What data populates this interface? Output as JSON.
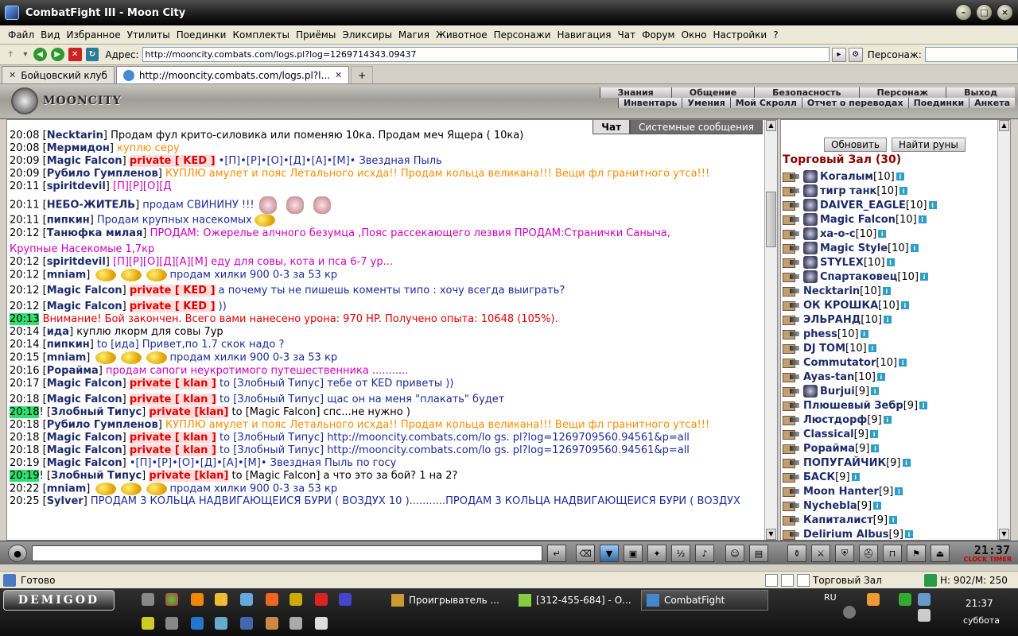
{
  "window": {
    "title": "CombatFight III - Moon City"
  },
  "menu": [
    "Файл",
    "Вид",
    "Избранное",
    "Утилиты",
    "Поединки",
    "Комплекты",
    "Приёмы",
    "Эликсиры",
    "Магия",
    "Животное",
    "Персонажи",
    "Навигация",
    "Чат",
    "Форум",
    "Окно",
    "Настройки",
    "?"
  ],
  "address": {
    "label": "Адрес:",
    "url": "http://mooncity.combats.com/logs.pl?log=1269714343.09437",
    "persona_label": "Персонаж:"
  },
  "tabs": [
    {
      "label": "Бойцовский клуб"
    },
    {
      "label": "http://mooncity.combats.com/logs.pl?l..."
    }
  ],
  "header": {
    "logo": "MOONCITY",
    "nav1": [
      "Знания",
      "Общение",
      "Безопасность",
      "Персонаж",
      "Выход"
    ],
    "nav2": [
      "Инвентарь",
      "Умения",
      "Мой Скролл",
      "Отчет о переводах",
      "Поединки",
      "Анкета"
    ]
  },
  "chat": {
    "tab_chat": "Чат",
    "tab_system": "Системные сообщения",
    "messages": [
      {
        "time": "20:08",
        "nick": "Necktarin",
        "text": "Продам фул крито-силовика или поменяю 10ка. Продам меч Ящера ( 10ка)",
        "color": "t-black"
      },
      {
        "time": "20:08",
        "nick": "Мермидон",
        "text": "куплю серу",
        "color": "t-orange"
      },
      {
        "time": "20:09",
        "nick": "Magic Falcon",
        "priv": "private [ KED ]",
        "text": "•[П]•[Р]•[О]•[Д]•[А]•[М]• Звездная Пыль",
        "color": "t-blue"
      },
      {
        "time": "20:09",
        "nick": "Рубило Гумпленов",
        "text": "КУПЛЮ амулет и пояс Летального исхда!! Продам кольца великана!!! Вещи фл гранитного утса!!!",
        "color": "t-orange"
      },
      {
        "time": "20:11",
        "nick": "spiritdevil",
        "text": "[П][Р][О][Д",
        "color": "t-pink"
      },
      {
        "time": "20:11",
        "nick": "НЕБО-ЖИТЕЛЬ",
        "text": "продам СВИНИНУ !!!",
        "color": "t-blue"
      },
      {
        "time": "20:11",
        "nick": "пипкин",
        "text": "Продам крупных насекомых",
        "color": "t-blue"
      },
      {
        "time": "20:12",
        "nick": "Танюфка милая",
        "text": "ПРОДАМ: Ожерелье алчного безумца ,Пояс рассекающего лезвия ПРОДАМ:Странички Саныча,",
        "color": "t-pink"
      },
      {
        "time": "",
        "nick": "",
        "text": "Крупные Насекомые 1,7кр",
        "color": "t-pink"
      },
      {
        "time": "20:12",
        "nick": "spiritdevil",
        "text": "[П][Р][О][Д][А][М] еду для совы, кота и пса 6-7 ур...",
        "color": "t-pink"
      },
      {
        "time": "20:12",
        "nick": "mniam",
        "text": "продам хилки 900 0-3 за 53 кр",
        "color": "t-blue"
      },
      {
        "time": "20:12",
        "nick": "Magic Falcon",
        "priv": "private [ KED ]",
        "text": "а почему ты не пишешь коменты типо : хочу всегда выиграть?",
        "color": "t-blue"
      },
      {
        "time": "20:12",
        "nick": "Magic Falcon",
        "priv": "private [ KED ]",
        "text": "))",
        "color": "t-blue"
      },
      {
        "time": "20:13",
        "nick": "",
        "text": "Внимание! Бой закончен. Всего вами нанесено урона: 970 HP. Получено опыта: 10648 (105%).",
        "color": "t-warn",
        "hl": true
      },
      {
        "time": "20:14",
        "nick": "ида",
        "text": "куплю лкорм для совы 7ур",
        "color": "t-black"
      },
      {
        "time": "20:14",
        "nick": "пипкин",
        "text": "to [ида] Привет,по 1.7 скок надо ?",
        "color": "t-blue"
      },
      {
        "time": "20:15",
        "nick": "mniam",
        "text": "продам хилки 900 0-3 за 53 кр",
        "color": "t-blue"
      },
      {
        "time": "20:16",
        "nick": "Рорайма",
        "text": "продам сапоги неукротимого путешественника ...........",
        "color": "t-pink"
      },
      {
        "time": "20:17",
        "nick": "Magic Falcon",
        "priv": "private [ klan ]",
        "text": "to [Злобный Типус] тебе от KED приветы ))",
        "color": "t-blue"
      },
      {
        "time": "20:18",
        "nick": "Magic Falcon",
        "priv": "private [ klan ]",
        "text": "to [Злобный Типус] щас он на меня \"плакать\" будет",
        "color": "t-blue"
      },
      {
        "time": "20:18",
        "nick": "Злобный Типус",
        "priv": "private [klan]",
        "text": "to [Magic Falcon] спс...не нужно )",
        "color": "t-black",
        "hl": true,
        "bang": true
      },
      {
        "time": "20:18",
        "nick": "Рубило Гумпленов",
        "text": "КУПЛЮ амулет и пояс Летального исхда!! Продам кольца великана!!! Вещи фл гранитного утса!!!",
        "color": "t-orange"
      },
      {
        "time": "20:18",
        "nick": "Magic Falcon",
        "priv": "private [ klan ]",
        "text": "to [Злобный Типус] http://mooncity.combats.com/lo gs. pl?log=1269709560.94561&p=all",
        "color": "t-blue"
      },
      {
        "time": "20:18",
        "nick": "Magic Falcon",
        "priv": "private [ klan ]",
        "text": "to [Злобный Типус] http://mooncity.combats.com/lo gs. pl?log=1269709560.94561&p=all",
        "color": "t-blue"
      },
      {
        "time": "20:19",
        "nick": "Magic Falcon",
        "text": "•[П]•[Р]•[О]•[Д]•[А]•[М]• Звездная Пыль по госу",
        "color": "t-blue"
      },
      {
        "time": "20:19",
        "nick": "Злобный Типус",
        "priv": "private [klan]",
        "text": "to [Magic Falcon] а что это за бой? 1 на 2?",
        "color": "t-black",
        "hl": true,
        "bang": true
      },
      {
        "time": "20:22",
        "nick": "mniam",
        "text": "продам хилки 900 0-3 за 53 кр",
        "color": "t-blue"
      },
      {
        "time": "20:25",
        "nick": "Sylver",
        "text": "ПРОДАМ 3 КОЛЬЦА НАДВИГАЮЩЕЙСЯ БУРИ ( ВОЗДУХ 10 )...........ПРОДАМ 3 КОЛЬЦА НАДВИГАЮЩЕЙСЯ БУРИ ( ВОЗДУХ",
        "color": "t-blue"
      }
    ]
  },
  "side": {
    "refresh": "Обновить",
    "find_runes": "Найти руны",
    "room_title": "Торговый Зал (30)",
    "users": [
      {
        "name": "Когалым",
        "lvl": "[10]",
        "clan": true
      },
      {
        "name": "тигр танк",
        "lvl": "[10]",
        "clan": true
      },
      {
        "name": "DAIVER_EAGLE",
        "lvl": "[10]",
        "clan": true
      },
      {
        "name": "Magic Falcon",
        "lvl": "[10]",
        "clan": true
      },
      {
        "name": "ха-о-с",
        "lvl": "[10]",
        "clan": true
      },
      {
        "name": "Magic Style",
        "lvl": "[10]",
        "clan": true
      },
      {
        "name": "STYLEX",
        "lvl": "[10]",
        "clan": true
      },
      {
        "name": "Спартаковец",
        "lvl": "[10]",
        "clan": true
      },
      {
        "name": "Necktarin",
        "lvl": "[10]",
        "clan": false
      },
      {
        "name": "ОК КРОШКА",
        "lvl": "[10]",
        "clan": false
      },
      {
        "name": "ЭЛЬРАНД",
        "lvl": "[10]",
        "clan": false
      },
      {
        "name": "phess",
        "lvl": "[10]",
        "clan": false
      },
      {
        "name": "DJ TOM",
        "lvl": "[10]",
        "clan": false
      },
      {
        "name": "Commutator",
        "lvl": "[10]",
        "clan": false
      },
      {
        "name": "Ayas-tan",
        "lvl": "[10]",
        "clan": false
      },
      {
        "name": "Burjui",
        "lvl": "[9]",
        "clan": true
      },
      {
        "name": "Плюшевый Зебр",
        "lvl": "[9]",
        "clan": false
      },
      {
        "name": "Люстдорф",
        "lvl": "[9]",
        "clan": false
      },
      {
        "name": "Classical",
        "lvl": "[9]",
        "clan": false
      },
      {
        "name": "Рорайма",
        "lvl": "[9]",
        "clan": false
      },
      {
        "name": "ПОПУГАЙЧИК",
        "lvl": "[9]",
        "clan": false
      },
      {
        "name": "БАСК",
        "lvl": "[9]",
        "clan": false
      },
      {
        "name": "Moon Hanter",
        "lvl": "[9]",
        "clan": false
      },
      {
        "name": "Nychebla",
        "lvl": "[9]",
        "clan": false
      },
      {
        "name": "Капиталист",
        "lvl": "[9]",
        "clan": false
      },
      {
        "name": "Delirium Albus",
        "lvl": "[9]",
        "clan": false
      }
    ]
  },
  "bottom": {
    "clock": "21:37",
    "clock_label": "CLOCK TIMER"
  },
  "status": {
    "text": "Готово",
    "room": "Торговый Зал",
    "hp": "Н: 902/М: 250"
  },
  "taskbar": {
    "start": "DEMIGOD",
    "tasks": [
      "Проигрыватель ...",
      "[312-455-684] - О...",
      "CombatFight"
    ],
    "lang": "RU",
    "time": "21:37",
    "day": "суббота"
  }
}
